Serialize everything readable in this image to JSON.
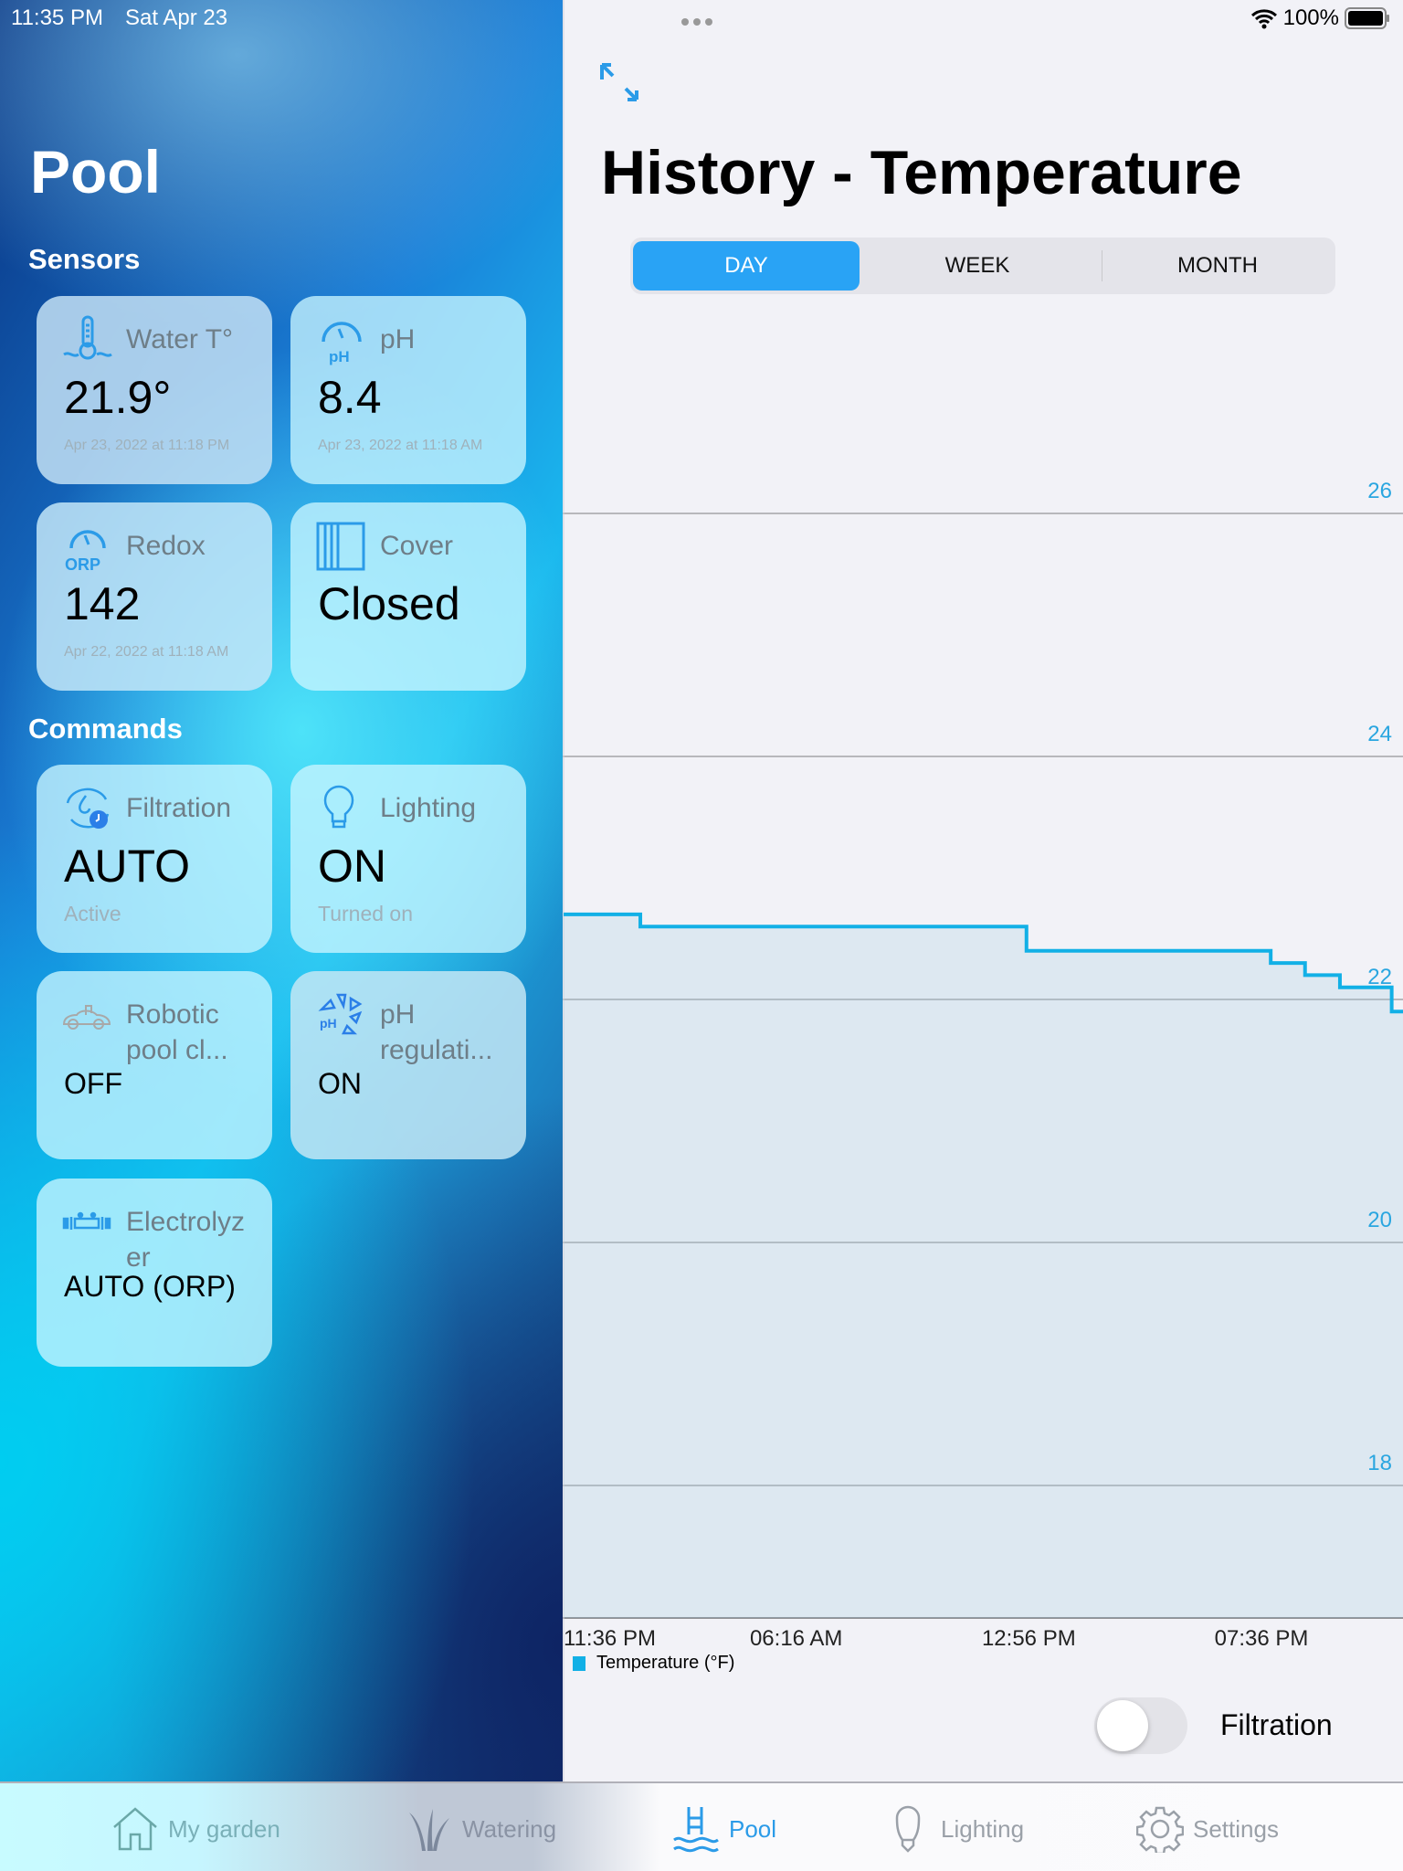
{
  "status_bar": {
    "time": "11:35 PM",
    "date": "Sat Apr 23",
    "battery": "100%"
  },
  "sidebar": {
    "title": "Pool",
    "sensors_label": "Sensors",
    "sensors": [
      {
        "label": "Water T°",
        "value": "21.9°",
        "date": "Apr 23, 2022 at 11:18 PM",
        "icon": "thermometer-water-icon"
      },
      {
        "label": "pH",
        "value": "8.4",
        "date": "Apr 23, 2022 at 11:18 AM",
        "icon": "ph-gauge-icon"
      },
      {
        "label": "Redox",
        "value": "142",
        "date": "Apr 22, 2022 at 11:18 AM",
        "icon": "orp-gauge-icon"
      },
      {
        "label": "Cover",
        "value": "Closed",
        "icon": "pool-cover-icon"
      }
    ],
    "commands_label": "Commands",
    "commands": [
      {
        "label": "Filtration",
        "value": "AUTO",
        "status": "Active",
        "icon": "filtration-cycle-icon"
      },
      {
        "label": "Lighting",
        "value": "ON",
        "status": "Turned on",
        "icon": "lightbulb-icon"
      },
      {
        "label": "Robotic pool cl...",
        "value": "OFF",
        "icon": "robot-cleaner-icon"
      },
      {
        "label": "pH regulati...",
        "value": "ON",
        "icon": "ph-regulation-icon"
      },
      {
        "label": "Electrolyzer",
        "value": "AUTO (ORP)",
        "icon": "electrolyzer-icon"
      }
    ]
  },
  "detail": {
    "title": "History - Temperature",
    "segments": [
      {
        "label": "DAY",
        "selected": true
      },
      {
        "label": "WEEK",
        "selected": false
      },
      {
        "label": "MONTH",
        "selected": false
      }
    ],
    "toggle": {
      "label": "Filtration",
      "on": false
    },
    "accent": "#29a3f5"
  },
  "chart_data": {
    "type": "line",
    "step": true,
    "area_fill": true,
    "color": "#12b0e6",
    "yticks": [
      26,
      24,
      22,
      20,
      18
    ],
    "ylim": [
      16.6,
      27.3
    ],
    "xticks": [
      "11:36 PM",
      "06:16 AM",
      "12:56 PM",
      "07:36 PM"
    ],
    "xrange": [
      "11:36 PM",
      "11:36 PM"
    ],
    "legend": "Temperature (°F)",
    "legend_position": "bottom-left",
    "grid": true,
    "points": [
      {
        "time": "11:36 PM",
        "value": 22.7
      },
      {
        "time": "01:48 AM",
        "value": 22.6
      },
      {
        "time": "12:52 PM",
        "value": 22.4
      },
      {
        "time": "07:52 PM",
        "value": 22.3
      },
      {
        "time": "08:51 PM",
        "value": 22.2
      },
      {
        "time": "09:51 PM",
        "value": 22.1
      },
      {
        "time": "11:20 PM",
        "value": 21.9
      }
    ]
  },
  "tabbar": {
    "items": [
      {
        "label": "My garden",
        "icon": "house-icon",
        "active": false
      },
      {
        "label": "Watering",
        "icon": "grass-icon",
        "active": false
      },
      {
        "label": "Pool",
        "icon": "pool-ladder-icon",
        "active": true
      },
      {
        "label": "Lighting",
        "icon": "lightbulb-icon",
        "active": false
      },
      {
        "label": "Settings",
        "icon": "gear-icon",
        "active": false
      }
    ]
  }
}
